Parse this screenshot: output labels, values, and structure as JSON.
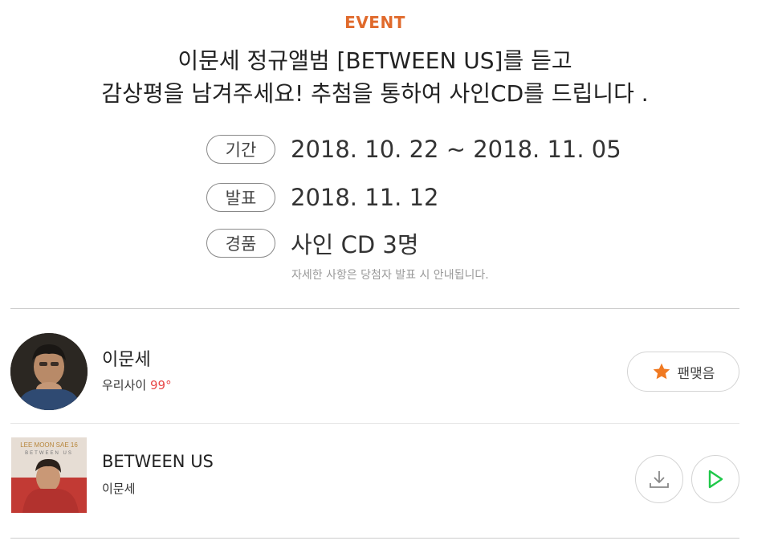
{
  "event": {
    "label": "EVENT",
    "headline_line1": "이문세 정규앨범 [BETWEEN US]를 듣고",
    "headline_line2": "감상평을 남겨주세요! 추첨을 통하여 사인CD를 드립니다 .",
    "details": [
      {
        "label": "기간",
        "value": "2018. 10. 22 ~ 2018. 11. 05"
      },
      {
        "label": "발표",
        "value": "2018. 11. 12"
      },
      {
        "label": "경품",
        "value": "사인 CD 3명"
      }
    ],
    "note": "자세한 사항은 당첨자 발표 시 안내됩니다."
  },
  "artist": {
    "name": "이문세",
    "closeness_label": "우리사이",
    "closeness_value": "99°",
    "fan_button_label": "팬맺음",
    "fan_icon": "star-icon"
  },
  "album": {
    "cover_text": "LEE MOON SAE 16",
    "cover_subtext": "BETWEEN US",
    "title": "BETWEEN US",
    "artist": "이문세",
    "download_icon": "download-icon",
    "play_icon": "play-icon"
  },
  "colors": {
    "accent": "#e06a2c",
    "degree": "#e84a4a",
    "play": "#1fc84a",
    "star": "#f07a22"
  }
}
